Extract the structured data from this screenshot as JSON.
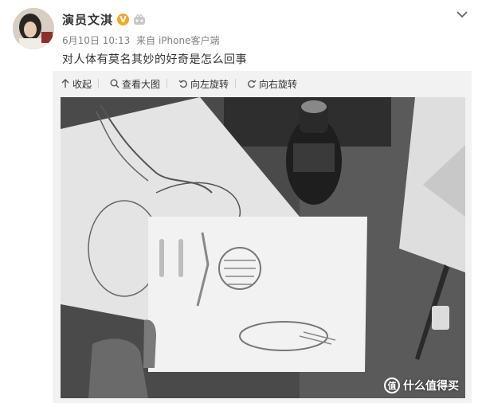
{
  "post": {
    "author": "演员文淇",
    "date": "6月10日 10:13",
    "source": "来自 iPhone客户端",
    "text": "对人体有莫名其妙的好奇是怎么回事"
  },
  "toolbar": {
    "collapse": "收起",
    "view_large": "查看大图",
    "rotate_left": "向左旋转",
    "rotate_right": "向右旋转"
  },
  "watermark": {
    "logo": "值",
    "text": "什么值得买"
  },
  "icons": {
    "verified": "verified-icon",
    "member": "vip-member-icon",
    "expand": "chevron-down-icon",
    "collapse": "arrow-up-icon",
    "zoom": "magnifier-icon",
    "rotate_left": "rotate-left-icon",
    "rotate_right": "rotate-right-icon"
  },
  "colors": {
    "verified_badge": "#f5a623",
    "meta_text": "#808080",
    "panel_bg": "#f2f2f2"
  }
}
